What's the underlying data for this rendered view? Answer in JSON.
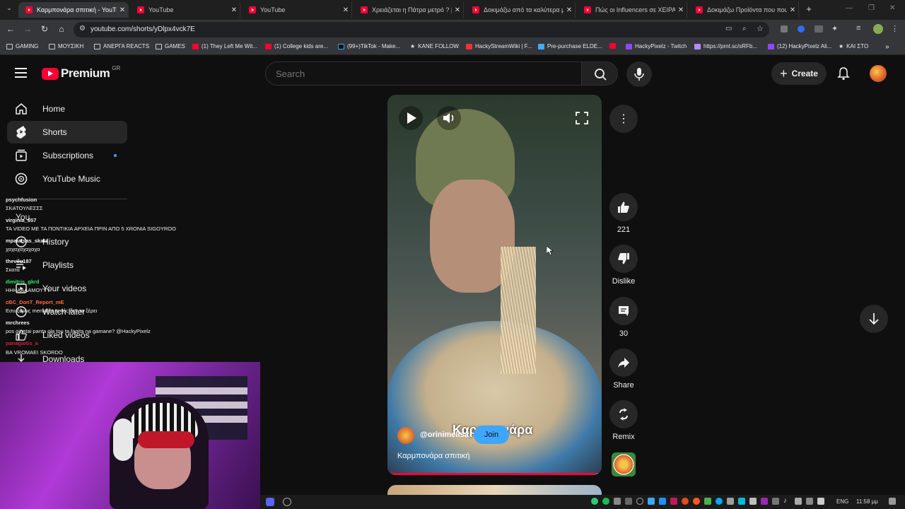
{
  "tabs": [
    {
      "title": "Καρμπονάρα σπιτική - YouTube",
      "active": true
    },
    {
      "title": "YouTube"
    },
    {
      "title": "YouTube"
    },
    {
      "title": "Χρειάζεται η Πάτρα μετρό ? |"
    },
    {
      "title": "Δοκιμάζω από τα καλύτερα μ"
    },
    {
      "title": "Πώς οι Influencers σε ΧΕΙΡΑΓΩ"
    },
    {
      "title": "Δοκιμάζω Προϊόντα που πουλ"
    }
  ],
  "address": {
    "url": "youtube.com/shorts/yDlpx4vck7E"
  },
  "bookmarks": [
    {
      "label": "GAMING",
      "icon": "folder-icon"
    },
    {
      "label": "ΜΟΥΣΙΚΗ",
      "icon": "folder-icon"
    },
    {
      "label": "ΑΝΕΡΓΑ REACTS",
      "icon": "folder-icon"
    },
    {
      "label": "GAMES",
      "icon": "folder-icon"
    },
    {
      "label": "(1) They Left Me Wit...",
      "icon": "youtube-icon"
    },
    {
      "label": "(1) College kids are...",
      "icon": "youtube-icon"
    },
    {
      "label": "(99+)TikTok - Make...",
      "icon": "tiktok-icon"
    },
    {
      "label": "KANE FOLLOW",
      "icon": "star-icon"
    },
    {
      "label": "HackyStreamWiki | F...",
      "icon": "page-icon"
    },
    {
      "label": "Pre-purchase ELDE...",
      "icon": "page-icon"
    },
    {
      "label": "HackyPixelz - Twitch",
      "icon": "twitch-icon"
    },
    {
      "label": "https://prnt.sc/sRFb...",
      "icon": "feather-icon"
    },
    {
      "label": "(12) HackyPixelz Ali...",
      "icon": "twitch-icon"
    },
    {
      "label": "ΚΑΙ ΣΤΟ",
      "icon": "star-icon"
    }
  ],
  "header": {
    "logo_text": "Premium",
    "region": "GR",
    "search_placeholder": "Search",
    "create_label": "Create"
  },
  "sidebar": {
    "items": [
      {
        "label": "Home",
        "icon": "home-icon"
      },
      {
        "label": "Shorts",
        "icon": "shorts-icon",
        "active": true
      },
      {
        "label": "Subscriptions",
        "icon": "subscriptions-icon"
      },
      {
        "label": "YouTube Music",
        "icon": "music-icon"
      }
    ],
    "you_label": "You",
    "you_items": [
      {
        "label": "History",
        "icon": "history-icon"
      },
      {
        "label": "Playlists",
        "icon": "playlists-icon"
      },
      {
        "label": "Your videos",
        "icon": "your-videos-icon"
      },
      {
        "label": "Watch later",
        "icon": "watch-later-icon"
      },
      {
        "label": "Liked videos",
        "icon": "like-icon"
      },
      {
        "label": "Downloads",
        "icon": "download-icon"
      }
    ]
  },
  "chat": [
    {
      "user": "psychfusion",
      "text": "ΣΚΑΤΟΥΛΕΣΣΣ",
      "color": "#ffffff"
    },
    {
      "user": "virginia_657",
      "text": "ΤΑ VIDEO ΜΕ ΤΑ ΠΟΝΤΙΚΙΑ ΑΡΧΕΙΑ ΠΡΙΝ ΑΠΟ 5 XRONIA SIGOYROO",
      "color": "#ffffff"
    },
    {
      "user": "mpalatsas_skata",
      "text": "χαχαχαχαχαχα",
      "color": "#ffffff"
    },
    {
      "user": "thevilu187",
      "text": "Σκατά",
      "color": "#ffffff"
    },
    {
      "user": "dimitris_gkrd",
      "text": "ΗΗΗΑΑΑΑΜΟΥΥΥ",
      "color": "#2ee66b"
    },
    {
      "user": "cBC_DonT_Report_mE",
      "text": "Eσυ ξέρεις mentalist αυτός δεν το ξέρει",
      "color": "#ff6a3d"
    },
    {
      "user": "mrchrees",
      "text": "pos ginetai panta ola tou ta faqita na gamane? @HackyPixelz",
      "color": "#ffffff"
    },
    {
      "user": "panagiotis_a",
      "text": "ΒΑ VROMAEI SKORDO",
      "color": "#d0203a"
    }
  ],
  "short": {
    "caption_overlay": "Καρμπονάρα",
    "channel": "@orinimelisa",
    "join_label": "Join",
    "title": "Καρμπονάρα σπιτική"
  },
  "actions": {
    "likes": "221",
    "dislike_label": "Dislike",
    "comments": "30",
    "share_label": "Share",
    "remix_label": "Remix"
  },
  "taskbar": {
    "language": "ENG",
    "time": "11:58 μμ"
  },
  "colors": {
    "accent": "#ff0033",
    "join": "#3ea6ff",
    "progress": "#ff0033"
  }
}
